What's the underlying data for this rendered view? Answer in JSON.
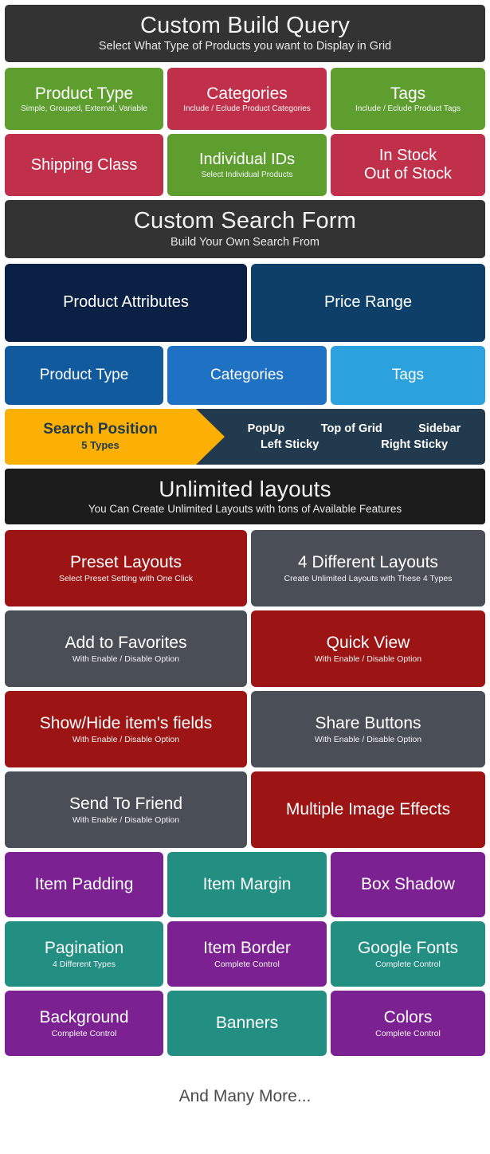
{
  "sections": {
    "query": {
      "title": "Custom Build Query",
      "subtitle": "Select What Type of Products you want to Display in Grid",
      "cards": [
        {
          "title": "Product Type",
          "sub": "Simple, Grouped, External, Variable",
          "color": "#5d9e2f"
        },
        {
          "title": "Categories",
          "sub": "Include / Eclude Product Categories",
          "color": "#c0304a"
        },
        {
          "title": "Tags",
          "sub": "Include / Eclude Product Tags",
          "color": "#5d9e2f"
        },
        {
          "title": "Shipping Class",
          "sub": "",
          "color": "#c0304a"
        },
        {
          "title": "Individual IDs",
          "sub": "Select Individual Products",
          "color": "#5d9e2f"
        },
        {
          "title": "In Stock\nOut of Stock",
          "sub": "",
          "color": "#c0304a"
        }
      ]
    },
    "search_form": {
      "title": "Custom Search Form",
      "subtitle": "Build Your Own Search From",
      "cards": [
        {
          "title": "Product Attributes",
          "color": "#0a2045"
        },
        {
          "title": "Price Range",
          "color": "#0e3f68"
        },
        {
          "title": "Product Type",
          "color": "#115a9e"
        },
        {
          "title": "Categories",
          "color": "#1f71c4"
        },
        {
          "title": "Tags",
          "color": "#2ba2dd"
        }
      ],
      "search_position": {
        "label": "Search Position",
        "sub": "5 Types",
        "arrow_color": "#fbb003",
        "panel_color": "#223a4e",
        "options_line1": [
          "PopUp",
          "Top of Grid",
          "Sidebar"
        ],
        "options_line2": [
          "Left Sticky",
          "Right Sticky"
        ]
      }
    },
    "layouts": {
      "title": "Unlimited layouts",
      "subtitle": "You Can Create Unlimited Layouts with tons of Available Features",
      "features": [
        {
          "title": "Preset Layouts",
          "sub": "Select Preset Setting with One Click",
          "color": "#9c1414"
        },
        {
          "title": "4 Different Layouts",
          "sub": "Create Unlimited Layouts with These 4 Types",
          "color": "#4a4f57"
        },
        {
          "title": "Add to Favorites",
          "sub": "With Enable / Disable Option",
          "color": "#4a4f57"
        },
        {
          "title": "Quick View",
          "sub": "With Enable / Disable Option",
          "color": "#9c1414"
        },
        {
          "title": "Show/Hide item's fields",
          "sub": "With Enable / Disable Option",
          "color": "#9c1414"
        },
        {
          "title": "Share Buttons",
          "sub": "With Enable / Disable Option",
          "color": "#4a4f57"
        },
        {
          "title": "Send To Friend",
          "sub": "With Enable / Disable Option",
          "color": "#4a4f57"
        },
        {
          "title": "Multiple Image Effects",
          "sub": "",
          "color": "#9c1414"
        }
      ],
      "tiles": [
        {
          "title": "Item Padding",
          "sub": "",
          "color": "#7b2191"
        },
        {
          "title": "Item Margin",
          "sub": "",
          "color": "#238e82"
        },
        {
          "title": "Box Shadow",
          "sub": "",
          "color": "#7b2191"
        },
        {
          "title": "Pagination",
          "sub": "4 Different Types",
          "color": "#238e82"
        },
        {
          "title": "Item Border",
          "sub": "Complete Control",
          "color": "#7b2191"
        },
        {
          "title": "Google Fonts",
          "sub": "Complete Control",
          "color": "#238e82"
        },
        {
          "title": "Background",
          "sub": "Complete Control",
          "color": "#7b2191"
        },
        {
          "title": "Banners",
          "sub": "",
          "color": "#238e82"
        },
        {
          "title": "Colors",
          "sub": "Complete Control",
          "color": "#7b2191"
        }
      ]
    }
  },
  "footer": {
    "text": "And Many More..."
  }
}
